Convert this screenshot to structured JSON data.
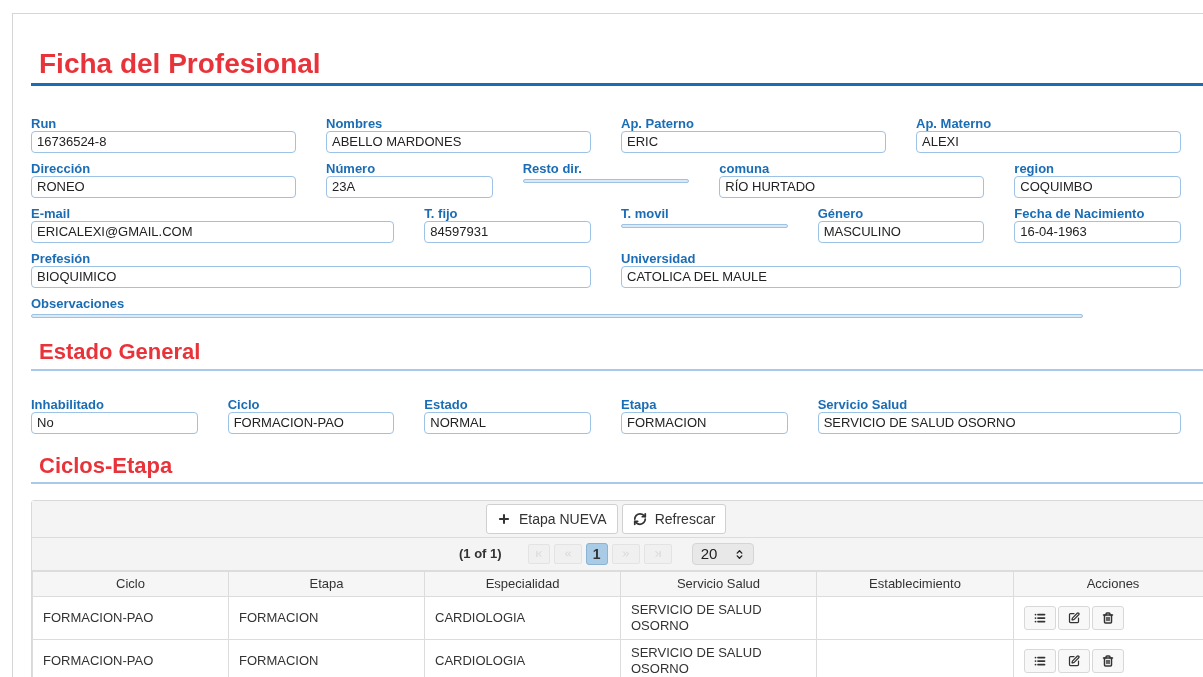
{
  "title": "Ficha del Profesional",
  "profile_fields": [
    {
      "label": "Run",
      "value": "16736524-8"
    },
    {
      "label": "Nombres",
      "value": "ABELLO MARDONES"
    },
    {
      "label": "Ap. Paterno",
      "value": "ERIC"
    },
    {
      "label": "Ap. Materno",
      "value": "ALEXI"
    },
    {
      "label": "Dirección",
      "value": "RONEO"
    },
    {
      "label": "Número",
      "value": "23A"
    },
    {
      "label": "Resto dir."
    },
    {
      "label": "comuna",
      "value": "RÍO HURTADO"
    },
    {
      "label": "region",
      "value": "COQUIMBO"
    },
    {
      "label": "E-mail",
      "value": "ERICALEXI@GMAIL.COM"
    },
    {
      "label": "T. fijo",
      "value": "84597931"
    },
    {
      "label": "T. movil"
    },
    {
      "label": "Género",
      "value": "MASCULINO"
    },
    {
      "label": "Fecha de Nacimiento",
      "value": "16-04-1963"
    },
    {
      "label": "Prefesión",
      "value": "BIOQUIMICO"
    },
    {
      "label": "Universidad",
      "value": "CATOLICA DEL MAULE"
    },
    {
      "label": "Observaciones"
    }
  ],
  "estado_title": "Estado General",
  "estado_fields": [
    {
      "label": "Inhabilitado",
      "value": "No"
    },
    {
      "label": "Ciclo",
      "value": "FORMACION-PAO"
    },
    {
      "label": "Estado",
      "value": "NORMAL"
    },
    {
      "label": "Etapa",
      "value": "FORMACION"
    },
    {
      "label": "Servicio Salud",
      "value": "SERVICIO DE SALUD OSORNO"
    }
  ],
  "ciclos_title": "Ciclos-Etapa",
  "toolbar": [
    {
      "kind": "add",
      "label": "Etapa NUEVA"
    },
    {
      "kind": "refresh",
      "label": "Refrescar"
    }
  ],
  "paginator": {
    "status": "(1 of 1)",
    "pages": [
      {
        "label": "1",
        "selected": true
      }
    ],
    "rows_per_page": "20"
  },
  "table": {
    "columns": [
      "Ciclo",
      "Etapa",
      "Especialidad",
      "Servicio Salud",
      "Establecimiento",
      "Acciones"
    ],
    "rows": [
      {
        "cells": [
          "FORMACION-PAO",
          "FORMACION",
          "CARDIOLOGIA",
          "SERVICIO DE SALUD OSORNO"
        ]
      },
      {
        "cells": [
          "FORMACION-PAO",
          "FORMACION",
          "CARDIOLOGIA",
          "SERVICIO DE SALUD OSORNO"
        ]
      }
    ]
  }
}
